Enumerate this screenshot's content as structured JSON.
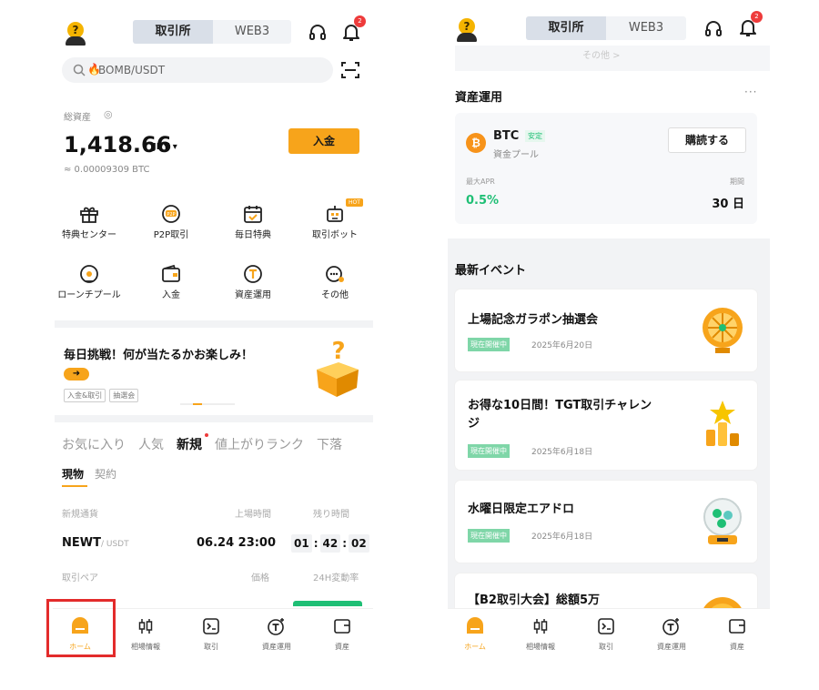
{
  "left": {
    "header": {
      "tab_exchange": "取引所",
      "tab_web3": "WEB3",
      "notif_count": "2"
    },
    "search": {
      "placeholder": "BOMB/USDT"
    },
    "assets": {
      "label": "総資産",
      "amount": "1,418.66",
      "currency": "JPY ▾",
      "btc_equiv": "≈ 0.00009309 BTC",
      "deposit_label": "入金"
    },
    "shortcuts": [
      {
        "label": "特典センター",
        "icon": "gift-icon"
      },
      {
        "label": "P2P取引",
        "icon": "p2p-icon"
      },
      {
        "label": "毎日特典",
        "icon": "calendar-icon"
      },
      {
        "label": "取引ボット",
        "icon": "bot-icon",
        "badge": "HOT"
      },
      {
        "label": "ローンチプール",
        "icon": "launchpool-icon"
      },
      {
        "label": "入金",
        "icon": "wallet-icon"
      },
      {
        "label": "資産運用",
        "icon": "earn-icon"
      },
      {
        "label": "その他",
        "icon": "more-icon"
      }
    ],
    "banner": {
      "title": "毎日挑戦！何が当たるかお楽しみ！",
      "arrow": "➜",
      "tags": [
        "入金&取引",
        "抽選会"
      ]
    },
    "market_tabs": [
      "お気に入り",
      "人気",
      "新規",
      "値上がりランク",
      "下落"
    ],
    "sub_tabs": [
      "現物",
      "契約"
    ],
    "table": {
      "col_new": "新規通貨",
      "col_listing": "上場時間",
      "col_remaining": "残り時間",
      "row": {
        "base": "NEWT",
        "quote": "/ USDT",
        "listing_time": "06.24 23:00",
        "h": "01",
        "m": "42",
        "s": "02"
      },
      "col_pair": "取引ペア",
      "col_price": "価格",
      "col_change": "24H変動率"
    },
    "tabbar": [
      "ホーム",
      "相場情報",
      "取引",
      "資産運用",
      "資産"
    ]
  },
  "right": {
    "header": {
      "tab_exchange": "取引所",
      "tab_web3": "WEB3",
      "notif_count": "2"
    },
    "prev_label": "その他 >",
    "earn": {
      "title": "資産運用",
      "more": "···",
      "coin": "BTC",
      "safe_tag": "安定",
      "pool": "資金プール",
      "buy_label": "購読する",
      "apr_label": "最大APR",
      "apr": "0.5%",
      "term_label": "期間",
      "term": "30 日"
    },
    "events": {
      "title": "最新イベント",
      "items": [
        {
          "title": "上場記念ガラポン抽選会",
          "status": "現在開催中",
          "date": "2025年6月20日"
        },
        {
          "title": "お得な10日間！TGT取引チャレンジ",
          "status": "現在開催中",
          "date": "2025年6月18日"
        },
        {
          "title": "水曜日限定エアドロ",
          "status": "現在開催中",
          "date": "2025年6月18日"
        },
        {
          "title": "【B2取引大会】総額5万",
          "status": "",
          "date": ""
        }
      ]
    },
    "tabbar": [
      "ホーム",
      "相場情報",
      "取引",
      "資産運用",
      "資産"
    ]
  },
  "colors": {
    "accent": "#f7a41b",
    "green": "#1fbf75",
    "highlight": "#e32b2b"
  }
}
